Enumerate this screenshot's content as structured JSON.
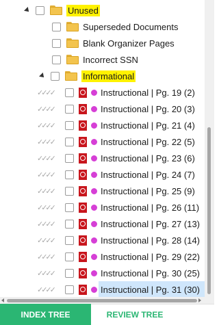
{
  "tree": {
    "unused": {
      "label": "Unused",
      "expanded": true
    },
    "unused_children": [
      "Superseded Documents",
      "Blank Organizer Pages",
      "Incorrect SSN"
    ],
    "informational": {
      "label": "Informational",
      "expanded": true
    },
    "status_marks": "✓✓✓✓",
    "documents": [
      "Instructional  | Pg. 19 (2)",
      "Instructional  | Pg. 20 (3)",
      "Instructional  | Pg. 21 (4)",
      "Instructional  | Pg. 22 (5)",
      "Instructional  | Pg. 23 (6)",
      "Instructional  | Pg. 24 (7)",
      "Instructional  | Pg. 25 (9)",
      "Instructional  | Pg. 26 (11)",
      "Instructional  | Pg. 27 (13)",
      "Instructional  | Pg. 28 (14)",
      "Instructional  | Pg. 29 (22)",
      "Instructional  | Pg. 30 (25)",
      "Instructional  | Pg. 31 (30)"
    ],
    "selected_index": 12
  },
  "tabs": {
    "index_tree": "INDEX TREE",
    "review_tree": "REVIEW TREE",
    "active": "index_tree"
  },
  "colors": {
    "highlight": "#fff200",
    "selection": "#cfe6fb",
    "tab_accent": "#2bb673",
    "pdf": "#c8161d",
    "tag_dot": "#d63fd6"
  }
}
